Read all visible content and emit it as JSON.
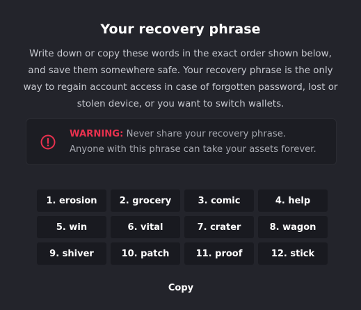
{
  "title": "Your recovery phrase",
  "description": "Write down or copy these words in the exact order shown below, and save them somewhere safe. Your recovery phrase is the only way to regain account access in case of forgotten password, lost or stolen device, or you want to switch wallets.",
  "warning": {
    "icon": "alert-circle-icon",
    "label": "WARNING:",
    "line1": "Never share your recovery phrase.",
    "line2": "Anyone with this phrase can take your assets forever."
  },
  "words": [
    "1. erosion",
    "2. grocery",
    "3. comic",
    "4. help",
    "5. win",
    "6. vital",
    "7. crater",
    "8. wagon",
    "9. shiver",
    "10. patch",
    "11. proof",
    "12. stick"
  ],
  "copy_label": "Copy",
  "colors": {
    "background": "#23242b",
    "warning_accent": "#e8314e",
    "word_chip": "#191a20"
  }
}
